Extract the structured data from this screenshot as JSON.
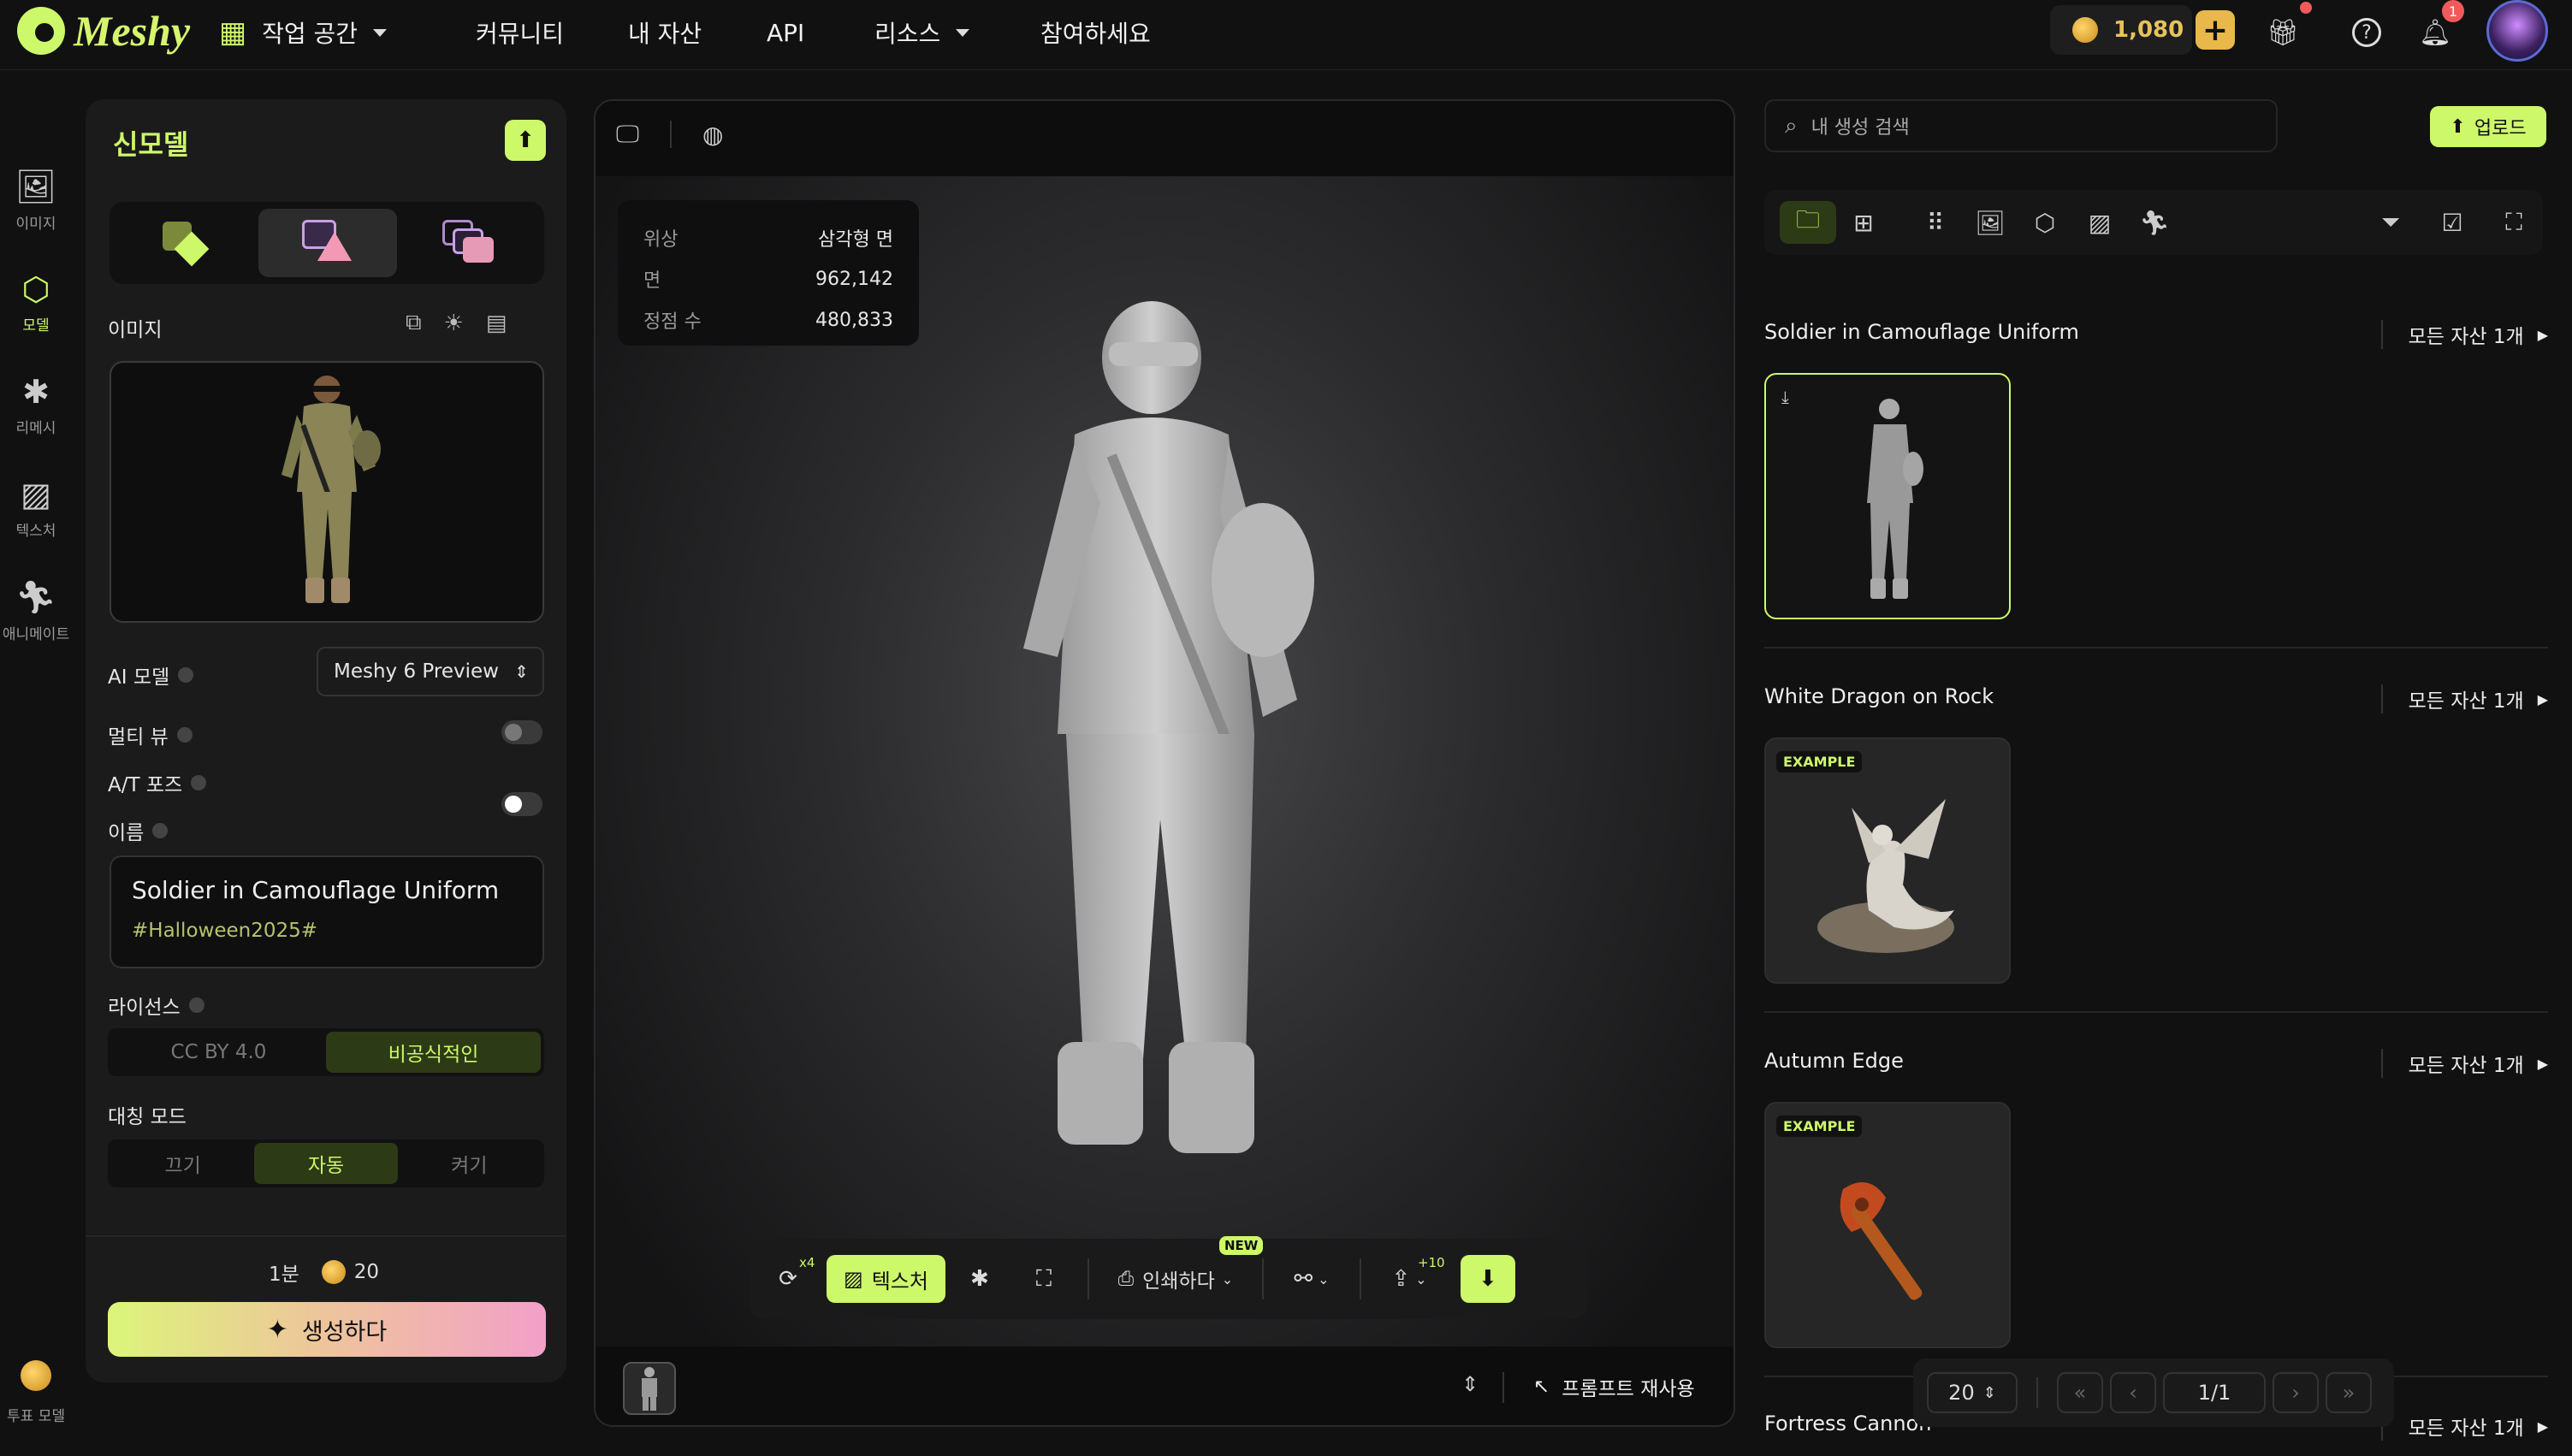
{
  "nav": {
    "logo": "Meshy",
    "workspace": "작업 공간",
    "community": "커뮤니티",
    "my_assets": "내 자산",
    "api": "API",
    "resources": "리소스",
    "join": "참여하세요",
    "credits": "1,080",
    "notif_count": "1"
  },
  "rail": {
    "image": "이미지",
    "model": "모델",
    "remesh": "리메시",
    "texture": "텍스처",
    "animate": "애니메이트",
    "vote": "투표 모델"
  },
  "panel": {
    "title": "신모델",
    "image_label": "이미지",
    "ai_model_label": "AI 모델",
    "ai_model_value": "Meshy 6 Preview",
    "multiview_label": "멀티 뷰",
    "at_pose_label": "A/T 포즈",
    "name_label": "이름",
    "name_value": "Soldier in Camouflage Uniform",
    "name_tag": "#Halloween2025#",
    "license_label": "라이선스",
    "license_options": [
      "CC BY 4.0",
      "비공식적인"
    ],
    "symmetry_label": "대칭 모드",
    "symmetry_options": [
      "끄기",
      "자동",
      "켜기"
    ],
    "time": "1분",
    "cost": "20",
    "generate": "생성하다"
  },
  "viewer": {
    "stats": [
      {
        "k": "위상",
        "v": "삼각형 면"
      },
      {
        "k": "면",
        "v": "962,142"
      },
      {
        "k": "정점 수",
        "v": "480,833"
      }
    ],
    "refresh_count": "x4",
    "texture_btn": "텍스처",
    "print_btn": "인쇄하다",
    "new_badge": "NEW",
    "share_count": "+10",
    "reuse_prompt": "프롬프트 재사용"
  },
  "right": {
    "search_placeholder": "내 생성 검색",
    "upload": "업로드",
    "sections": [
      {
        "title": "Soldier in Camouflage Uniform",
        "all": "모든 자산 1개",
        "badge": ""
      },
      {
        "title": "White Dragon on Rock",
        "all": "모든 자산 1개",
        "badge": "EXAMPLE"
      },
      {
        "title": "Autumn Edge",
        "all": "모든 자산 1개",
        "badge": "EXAMPLE"
      },
      {
        "title": "Fortress Cannon",
        "all": "모든 자산 1개"
      }
    ],
    "page_size": "20",
    "page": "1/1"
  },
  "colors": {
    "accent": "#cdf86a",
    "bg": "#111112",
    "panel": "#1b1b1c"
  }
}
